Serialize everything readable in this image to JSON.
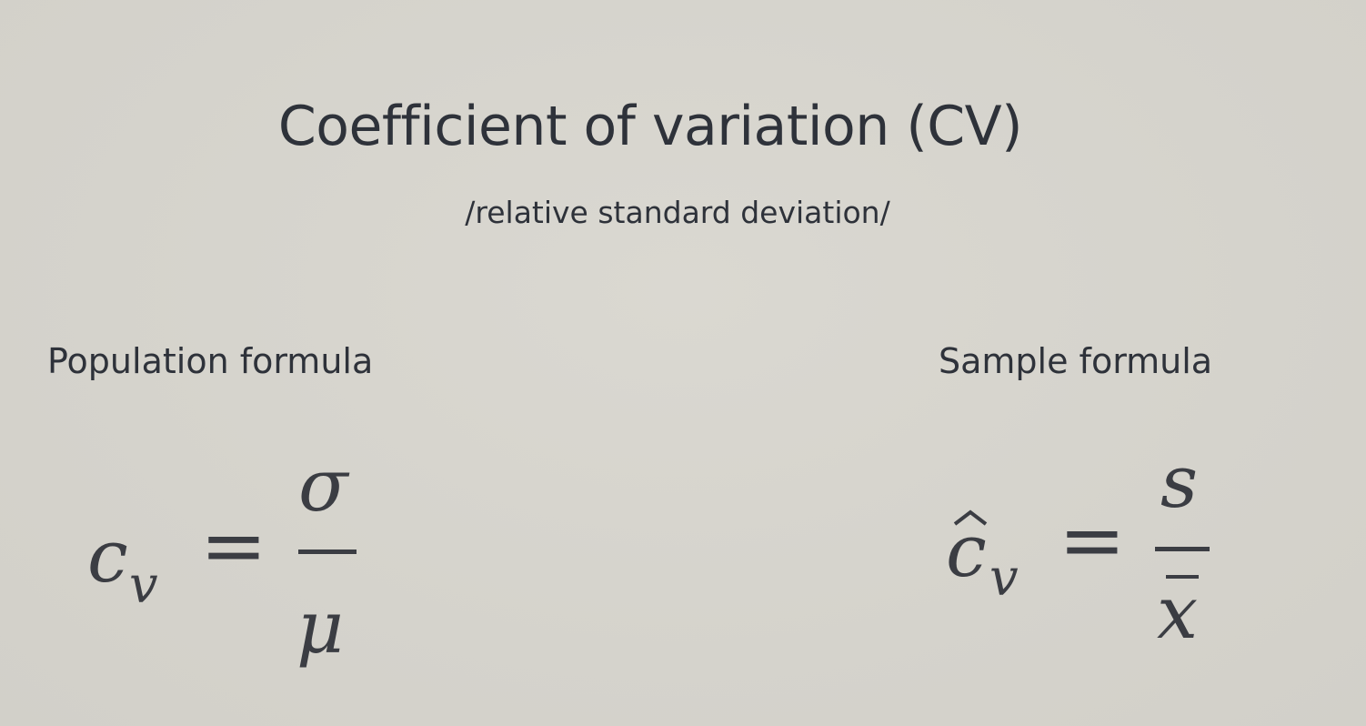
{
  "title": "Coefficient of variation (CV)",
  "subtitle": "/relative standard deviation/",
  "population": {
    "label": "Population formula",
    "lhs_var": "c",
    "lhs_sub": "v",
    "equals": "=",
    "numerator": "σ",
    "denominator": "μ"
  },
  "sample": {
    "label": "Sample formula",
    "lhs_var": "c",
    "lhs_sub": "v",
    "equals": "=",
    "numerator": "s",
    "denominator": "x"
  }
}
